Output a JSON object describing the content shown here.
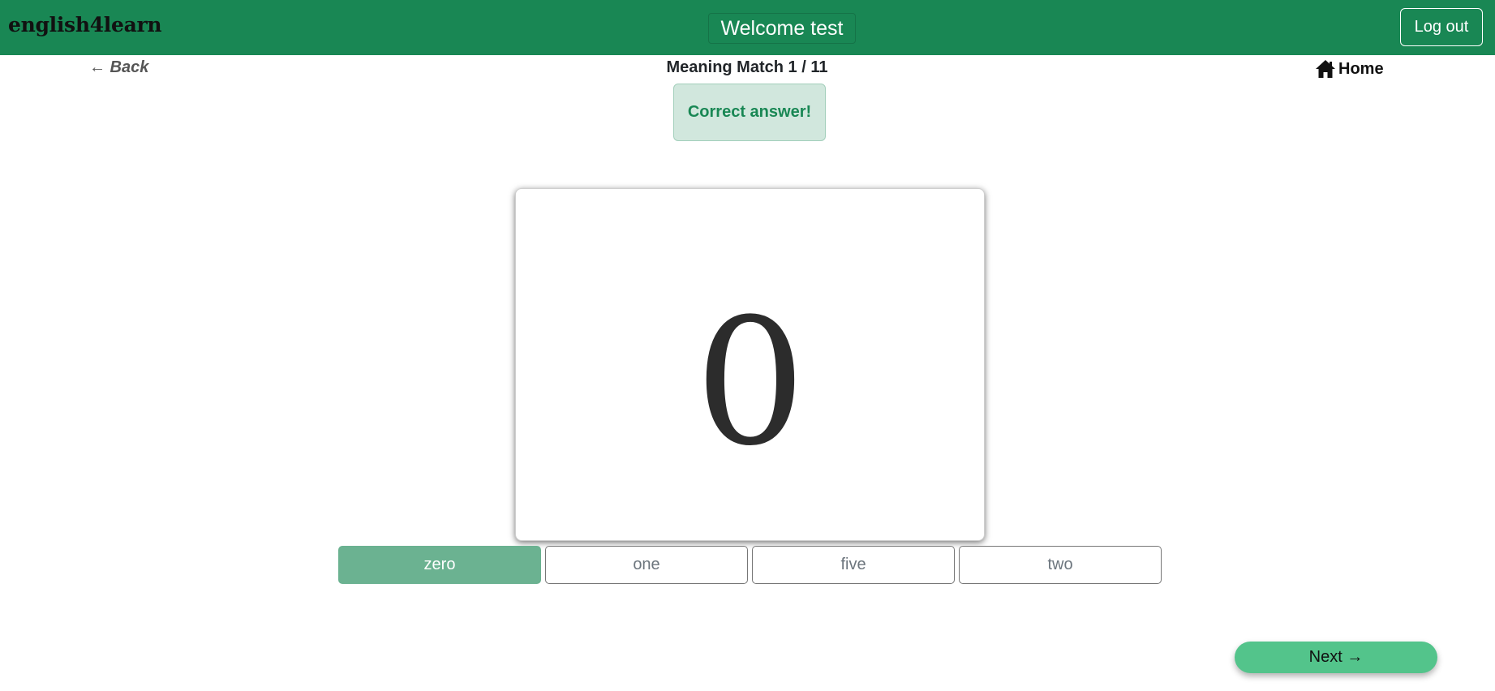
{
  "navbar": {
    "brand": "english4learn",
    "welcome": "Welcome test",
    "logout_label": "Log out"
  },
  "nav": {
    "back_label": "← Back",
    "title": "Meaning Match 1 / 11",
    "home_label": "Home",
    "home_icon": "home-icon"
  },
  "feedback": {
    "message": "Correct answer!"
  },
  "card": {
    "image_glyph": "0"
  },
  "options": [
    {
      "label": "zero",
      "selected": true
    },
    {
      "label": "one",
      "selected": false
    },
    {
      "label": "five",
      "selected": false
    },
    {
      "label": "two",
      "selected": false
    }
  ],
  "next_label": "Next →",
  "colors": {
    "navbar": "#198754",
    "alert_bg": "#d1e7dd",
    "alert_text": "#198754",
    "selected_option": "#6bb291",
    "next_button": "#53c48b"
  }
}
